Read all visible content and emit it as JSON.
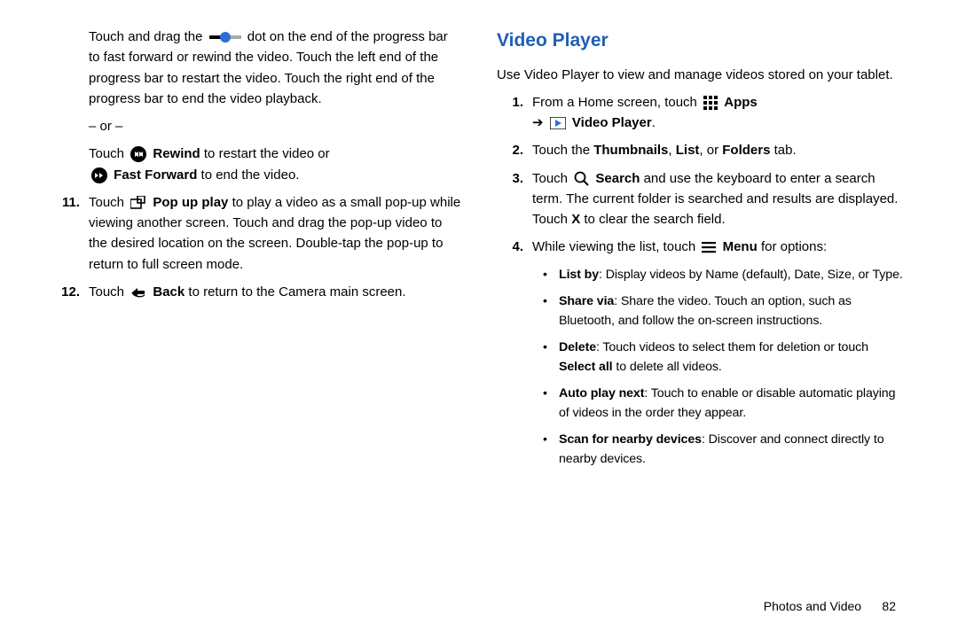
{
  "left": {
    "para1a": "Touch and drag the ",
    "para1b": " dot on the end of the progress bar to fast forward or rewind the video. Touch the left end of the progress bar to restart the video. Touch the right end of the progress bar to end the video playback.",
    "or": "– or –",
    "rewindA": "Touch ",
    "rewindBold": "Rewind",
    "rewindB": " to restart the video or ",
    "ffBold": "Fast Forward",
    "ffB": " to end the video.",
    "n11": "11.",
    "popA": "Touch ",
    "popBold": "Pop up play",
    "popB": " to play a video as a small pop-up while viewing another screen. Touch and drag the pop-up video to the desired location on the screen. Double-tap the pop-up to return to full screen mode.",
    "n12": "12.",
    "backA": "Touch ",
    "backBold": "Back",
    "backB": " to return to the Camera main screen."
  },
  "right": {
    "title": "Video Player",
    "intro": "Use Video Player to view and manage videos stored on your tablet.",
    "n1": "1.",
    "s1a": "From a Home screen, touch ",
    "s1aBold": "Apps",
    "s1arrow": "➔",
    "s1bBold": "Video Player",
    "s1bEnd": ".",
    "n2": "2.",
    "s2a": "Touch the ",
    "s2Thumb": "Thumbnails",
    "s2c1": ", ",
    "s2List": "List",
    "s2c2": ", or ",
    "s2Folders": "Folders",
    "s2tab": " tab.",
    "n3": "3.",
    "s3a": "Touch ",
    "s3Bold": "Search",
    "s3b": " and use the keyboard to enter a search term. The current folder is searched and results are displayed. Touch ",
    "s3X": "X",
    "s3c": " to clear the search field.",
    "n4": "4.",
    "s4a": "While viewing the list, touch ",
    "s4Bold": "Menu",
    "s4b": " for options:",
    "b1Bold": "List by",
    "b1": ": Display videos by Name (default), Date, Size, or Type.",
    "b2Bold": "Share via",
    "b2": ": Share the video. Touch an option, such as Bluetooth, and follow the on-screen instructions.",
    "b3Bold": "Delete",
    "b3a": ": Touch videos to select them for deletion or touch ",
    "b3SelectAll": "Select all",
    "b3b": " to delete all videos.",
    "b4Bold": "Auto play next",
    "b4": ": Touch to enable or disable automatic playing of videos in the order they appear.",
    "b5Bold": "Scan for nearby devices",
    "b5": ": Discover and connect directly to nearby devices."
  },
  "footer": {
    "section": "Photos and Video",
    "page": "82"
  }
}
